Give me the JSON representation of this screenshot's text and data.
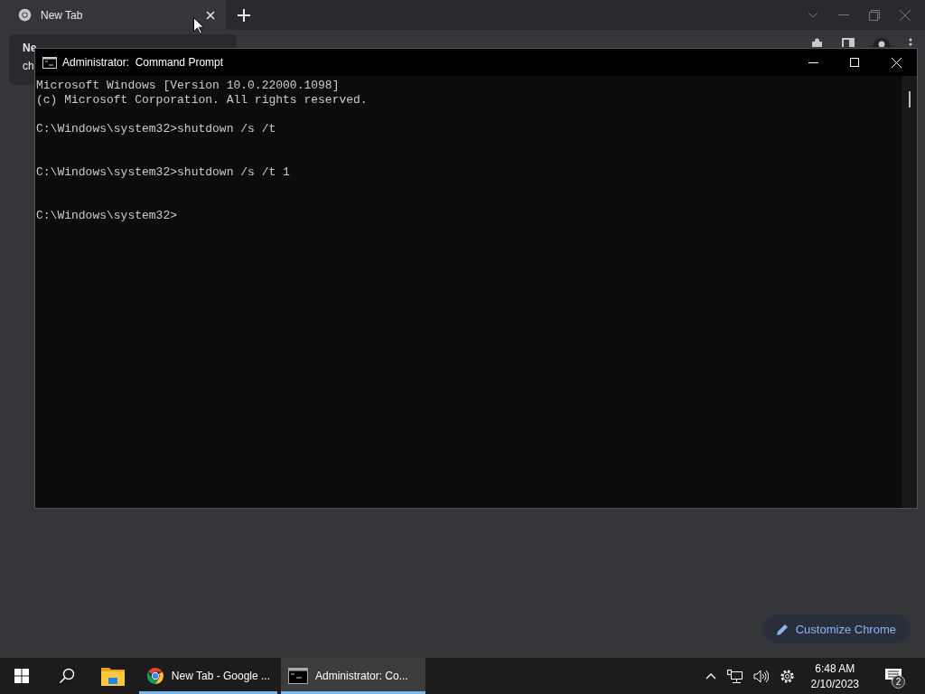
{
  "browser": {
    "tab": {
      "title": "New Tab",
      "selected": true
    },
    "tooltip": {
      "lines": [
        "Ne",
        "ch"
      ]
    },
    "customize_button": "Customize Chrome"
  },
  "console": {
    "title": "Administrator:  Command Prompt",
    "lines": [
      {
        "kind": "banner",
        "text": "Microsoft Windows [Version 10.0.22000.1098]"
      },
      {
        "kind": "banner",
        "text": "(c) Microsoft Corporation. All rights reserved."
      },
      {
        "kind": "command",
        "text": "C:\\Windows\\system32>shutdown /s /t"
      },
      {
        "kind": "command",
        "text": "C:\\Windows\\system32>shutdown /s /t 1"
      },
      {
        "kind": "prompt",
        "text": "C:\\Windows\\system32>"
      }
    ]
  },
  "taskbar": {
    "items": [
      {
        "kind": "start",
        "selected": false
      },
      {
        "kind": "search",
        "selected": false
      },
      {
        "kind": "explorer",
        "selected": false
      },
      {
        "kind": "chrome",
        "label": "New Tab - Google ...",
        "selected": false
      },
      {
        "kind": "console",
        "label": "Administrator:  Co...",
        "selected": true
      }
    ],
    "tray": {
      "time": "6:48 AM",
      "date": "2/10/2023",
      "notifications": "2"
    }
  }
}
